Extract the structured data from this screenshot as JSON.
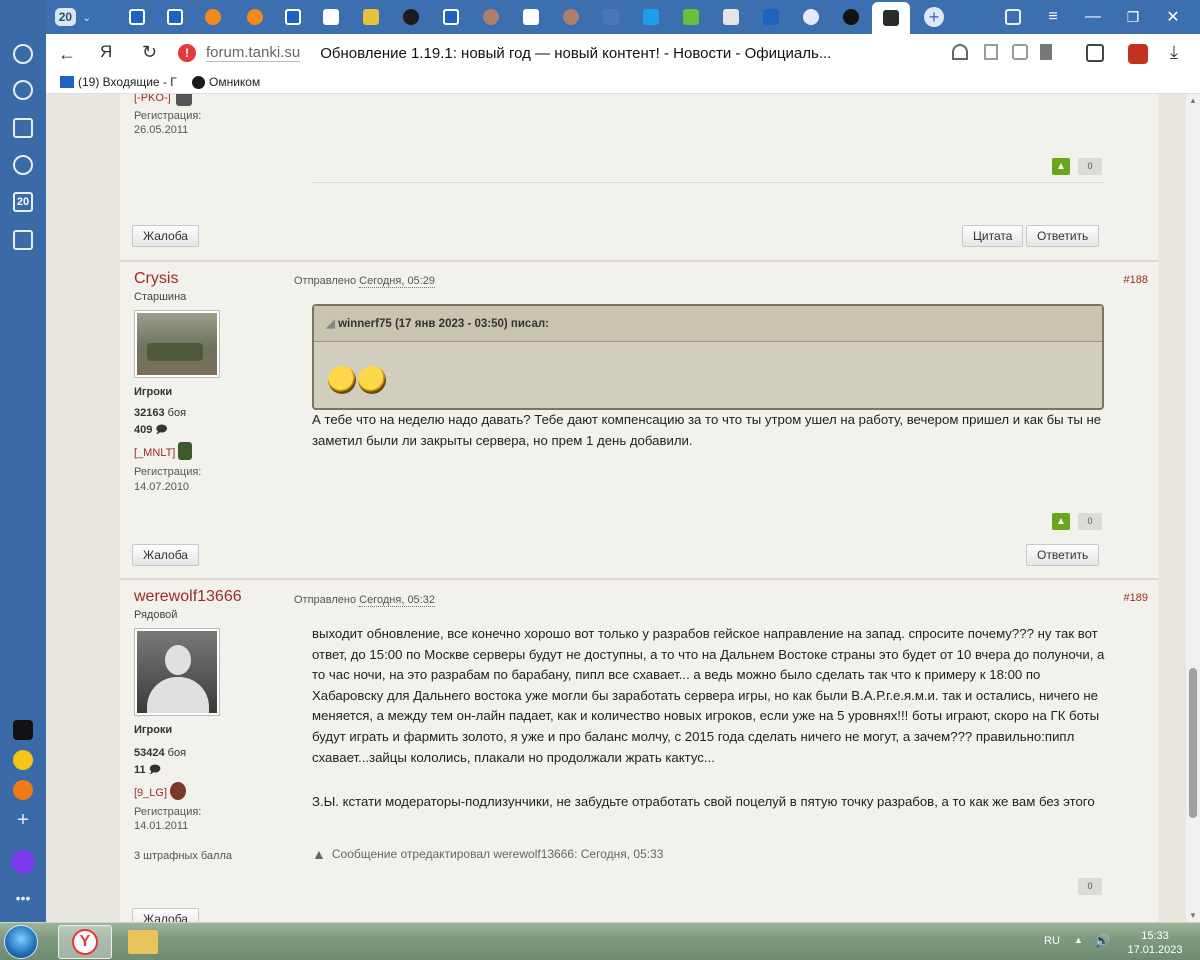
{
  "browser": {
    "tab_count_badge": "20",
    "url_host": "forum.tanki.su",
    "page_title": "Обновление 1.19.1: новый год — новый контент! - Новости - Официаль...",
    "bookmarks": [
      {
        "label": "(19) Входящие - Г"
      },
      {
        "label": "Омником"
      }
    ],
    "sidebar_badge": "20"
  },
  "prev_post": {
    "clan": "[-PKO-]",
    "reg_label": "Регистрация:",
    "reg_date": "26.05.2011",
    "vote_count": "0",
    "report_label": "Жалоба",
    "quote_label": "Цитата",
    "reply_label": "Ответить"
  },
  "post188": {
    "author": "Crysis",
    "rank": "Старшина",
    "group": "Игроки",
    "battles_value": "32163",
    "battles_label": "боя",
    "posts_count": "409",
    "clan": "[_MNLT]",
    "reg_label": "Регистрация:",
    "reg_date": "14.07.2010",
    "sent_label": "Отправлено",
    "sent_date": "Сегодня, 05:29",
    "number": "#188",
    "quote_header": "winnerf75 (17 янв 2023 - 03:50) писал:",
    "text": "А тебе что на неделю надо давать? Тебе дают компенсацию за то что ты утром ушел на работу, вечером пришел и как бы ты не заметил были ли закрыты сервера, но прем 1 день добавили.",
    "vote_count": "0",
    "report_label": "Жалоба",
    "reply_label": "Ответить"
  },
  "post189": {
    "author": "werewolf13666",
    "rank": "Рядовой",
    "group": "Игроки",
    "battles_value": "53424",
    "battles_label": "боя",
    "posts_count": "11",
    "clan": "[9_LG]",
    "reg_label": "Регистрация:",
    "reg_date": "14.01.2011",
    "penalty": "3 штрафных балла",
    "sent_label": "Отправлено",
    "sent_date": "Сегодня, 05:32",
    "number": "#189",
    "text": "выходит обновление, все конечно хорошо вот только у разрабов гейское направление на запад. спросите почему??? ну так вот ответ, до 15:00  по Москве серверы будут не доступны, а то что на Дальнем Востоке страны это будет от 10 вчера до полуночи, а то час ночи, на это разрабам по барабану, пипл все схавает... а ведь можно было сделать так что к примеру к 18:00 по Хабаровску для Дальнего востока уже могли бы заработать сервера игры, но как были В.А.Р.г.е.я.м.и. так и остались, ничего не меняется, а между тем он-лайн падает, как и количество новых игроков, если уже на 5 уровнях!!! боты играют, скоро на ГК боты будут играть и фармить золото, я уже и про баланс молчу, с 2015 года сделать ничего не могут, а зачем??? правильно:пипл схавает...зайцы кололись, плакали но продолжали жрать кактус...",
    "ps": "З.Ы. кстати модераторы-подлизунчики, не забудьте отработать свой поцелуй в пятую точку разрабов, а то как же вам без этого",
    "edited": "Сообщение отредактировал werewolf13666: Сегодня, 05:33",
    "vote_count": "0",
    "report_label": "Жалоба"
  },
  "taskbar": {
    "lang": "RU",
    "time": "15:33",
    "date": "17.01.2023"
  }
}
